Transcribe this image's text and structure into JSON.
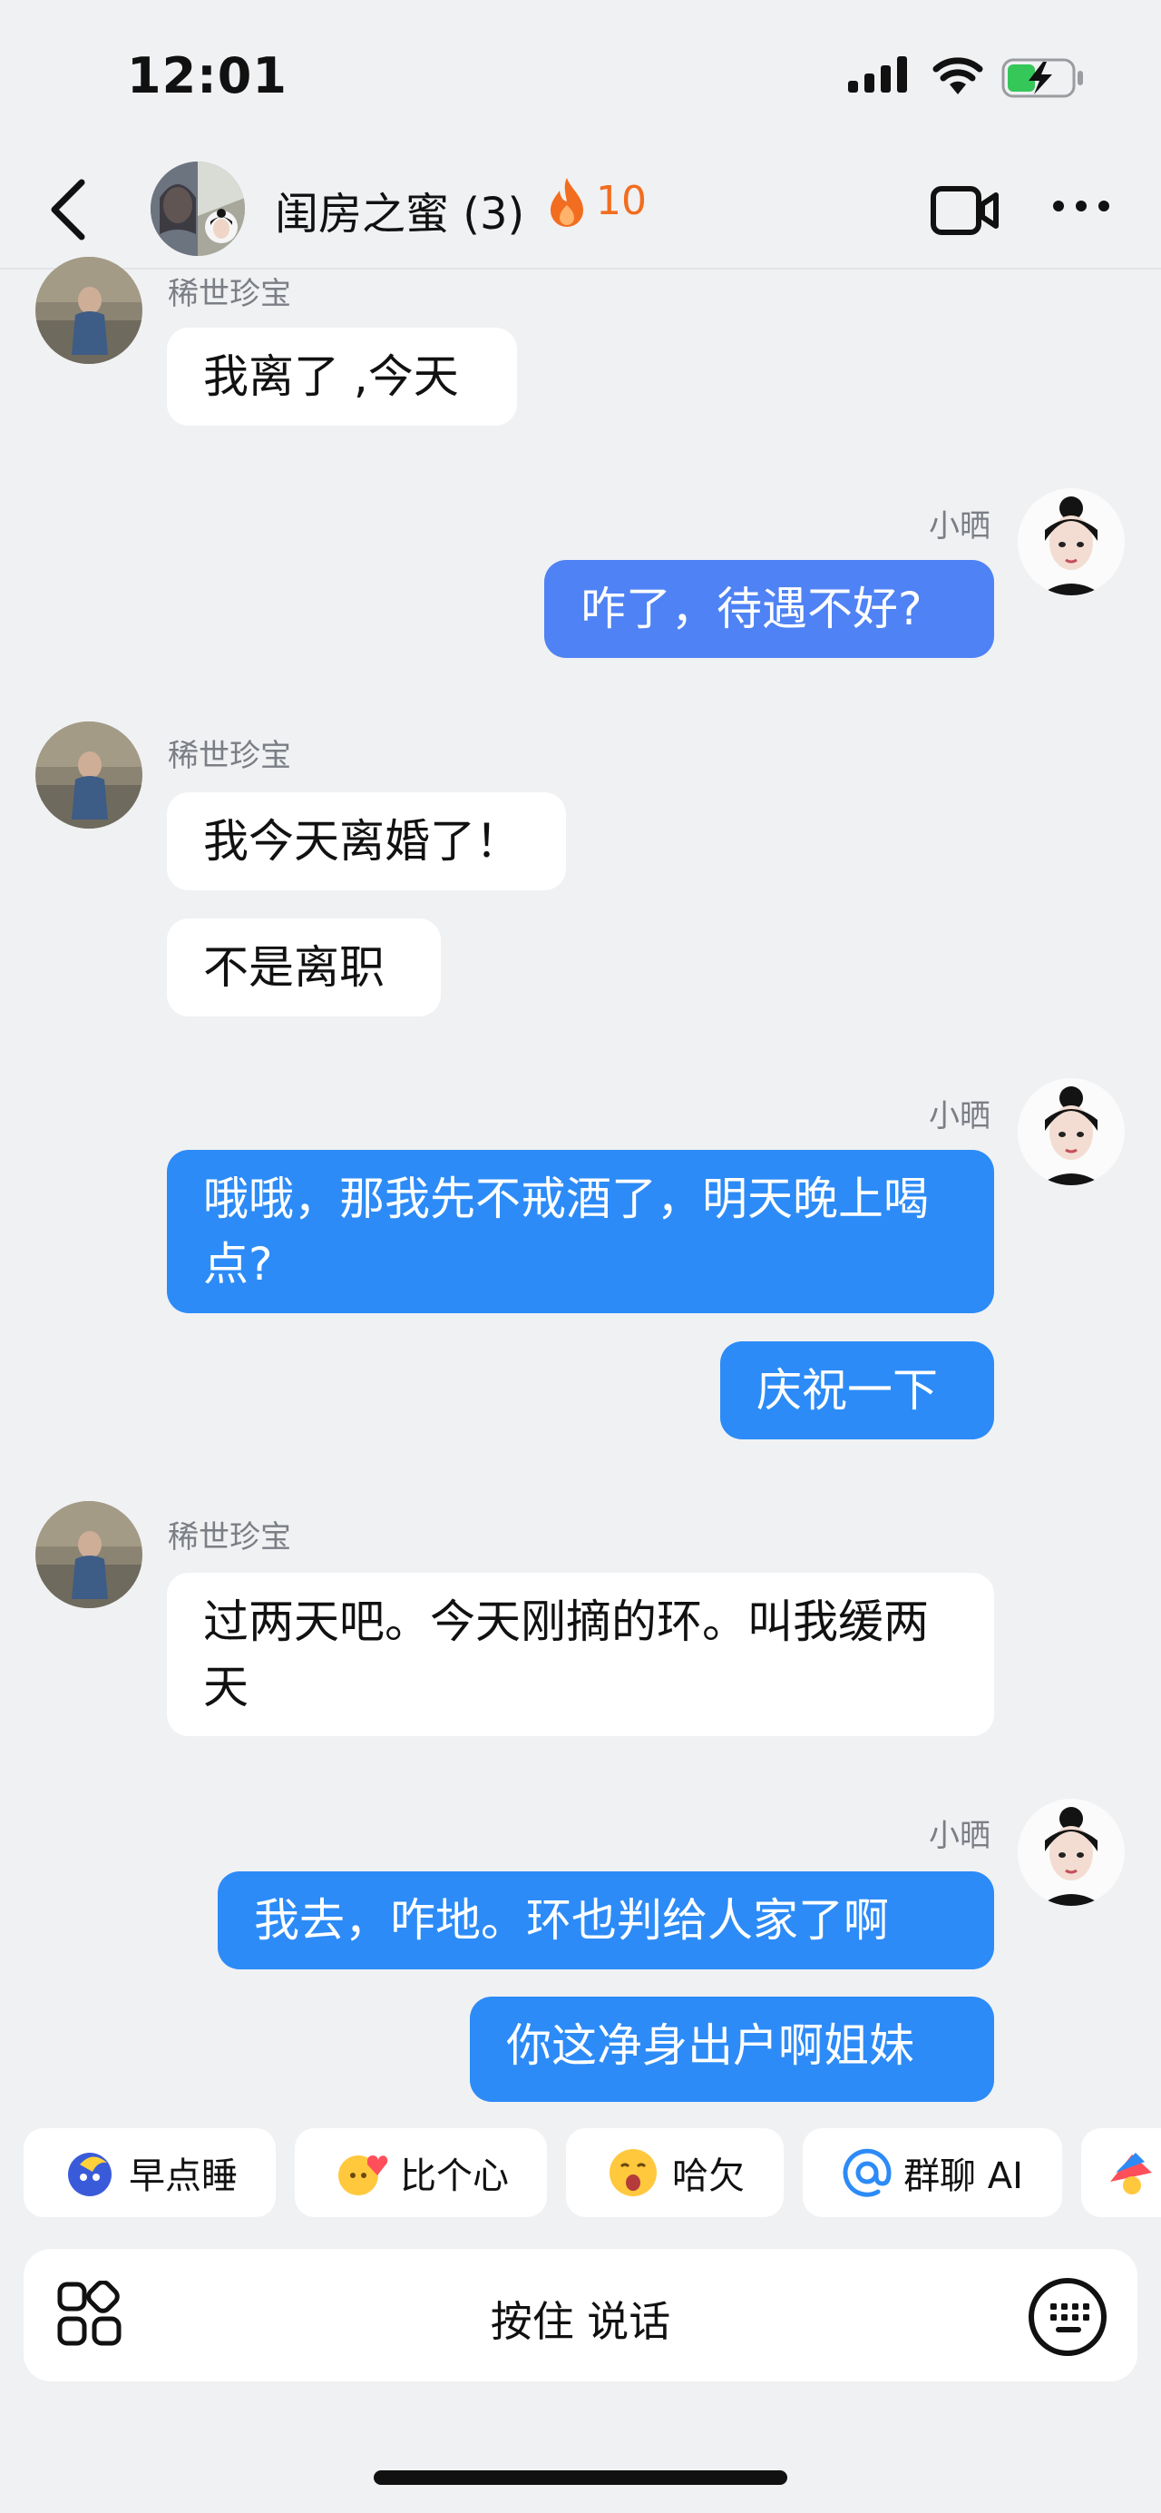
{
  "status_bar": {
    "time": "12:01"
  },
  "header": {
    "title": "闺房之蜜 (3)",
    "streak_count": "10"
  },
  "messages": [
    {
      "sender": "稀世珍宝",
      "text": "我离了 ,今天"
    },
    {
      "sender": "小晒",
      "text": "咋了，待遇不好?"
    },
    {
      "sender": "稀世珍宝",
      "text": "我今天离婚了！"
    },
    {
      "text": "不是离职"
    },
    {
      "sender": "小晒",
      "text": "哦哦，那我先不戒酒了，明天晚上喝点?"
    },
    {
      "text": "庆祝一下"
    },
    {
      "sender": "稀世珍宝",
      "text": "过两天吧。今天刚摘的环。叫我缓两天"
    },
    {
      "sender": "小晒",
      "text": "我去，咋地。环也判给人家了啊"
    },
    {
      "text": "你这净身出户啊姐妹"
    }
  ],
  "quick_replies": [
    "早点睡",
    "比个心",
    "哈欠",
    "群聊 AI"
  ],
  "input": {
    "hold_to_talk": "按住 说话"
  },
  "colors": {
    "bubble_out": "#2c8bf7",
    "bubble_in": "#ffffff",
    "background": "#f0f1f3",
    "streak": "#f26d1f"
  }
}
